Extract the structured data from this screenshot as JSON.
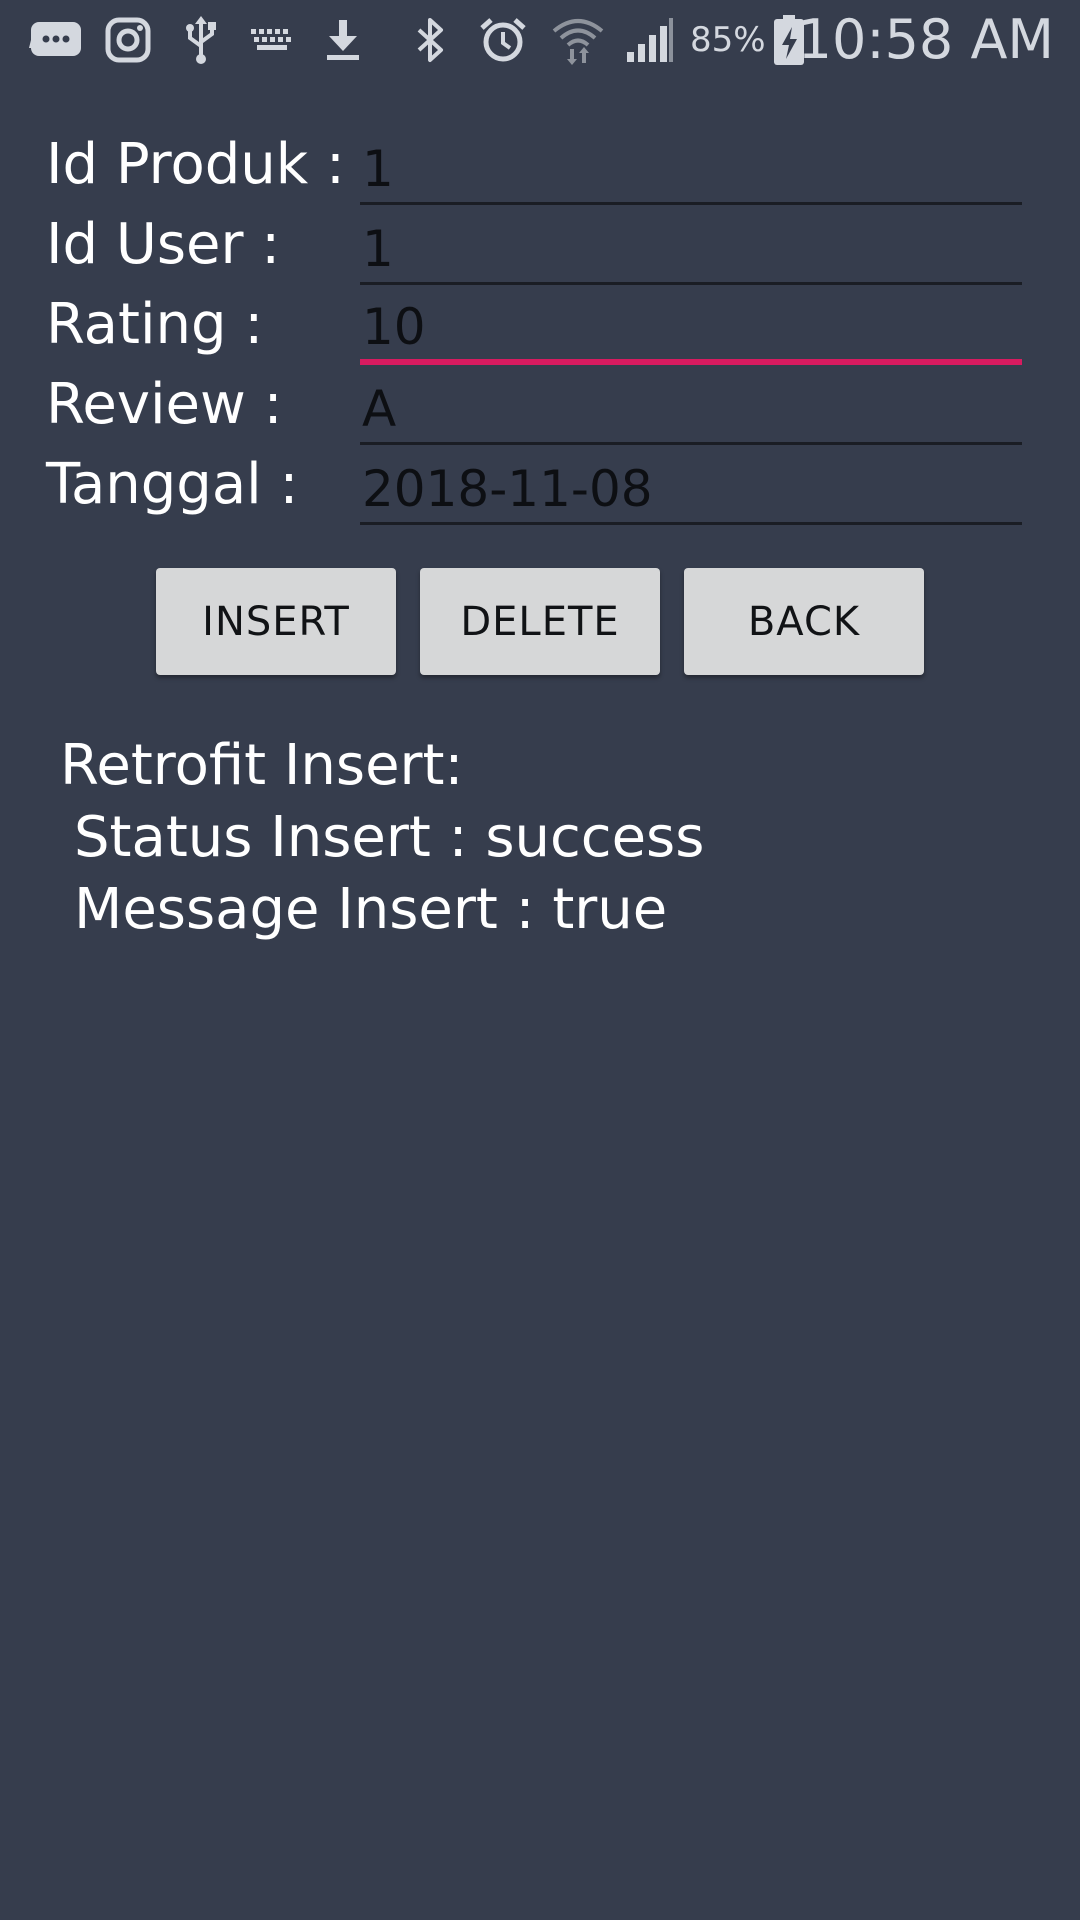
{
  "status_bar": {
    "icons": [
      "messenger-icon",
      "instagram-icon",
      "usb-icon",
      "keyboard-icon",
      "download-icon",
      "bluetooth-icon",
      "alarm-icon",
      "wifi-icon",
      "cellular-signal-icon",
      "battery-charging-icon"
    ],
    "battery_percent": "85%",
    "time": "10:58 AM"
  },
  "form": {
    "fields": [
      {
        "label": "Id Produk :",
        "value": "1"
      },
      {
        "label": "Id User :",
        "value": "1"
      },
      {
        "label": "Rating :",
        "value": "10"
      },
      {
        "label": "Review :",
        "value": "A"
      },
      {
        "label": "Tanggal :",
        "value": "2018-11-08"
      }
    ],
    "focused_field": "Rating :",
    "focus_color": "#d81b60"
  },
  "buttons": {
    "insert_label": "INSERT",
    "delete_label": "DELETE",
    "back_label": "BACK"
  },
  "result": {
    "title": "Retrofit Insert:",
    "status_line": "Status Insert : success",
    "message_line": "Message Insert : true"
  },
  "colors": {
    "background": "#363d4d",
    "button": "#d6d7d8"
  }
}
